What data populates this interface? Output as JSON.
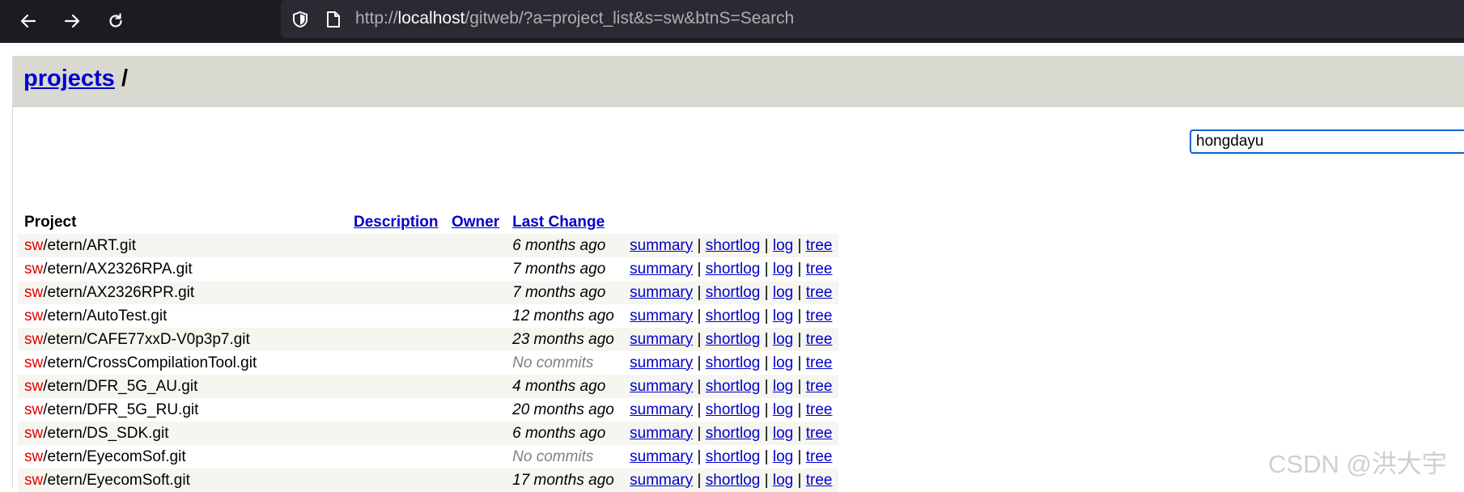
{
  "browser": {
    "url_scheme": "http://",
    "url_host": "localhost",
    "url_path": "/gitweb/?a=project_list&s=sw&btnS=Search"
  },
  "header": {
    "projects_link": "projects",
    "separator": "/"
  },
  "search": {
    "value": "hongdayu"
  },
  "table": {
    "columns": {
      "project": "Project",
      "description": "Description",
      "owner": "Owner",
      "last_change": "Last Change"
    },
    "links": {
      "summary": "summary",
      "shortlog": "shortlog",
      "log": "log",
      "tree": "tree",
      "divider": "|"
    },
    "rows": [
      {
        "prefix": "sw",
        "path": "/etern/ART.git",
        "age": "6 months ago"
      },
      {
        "prefix": "sw",
        "path": "/etern/AX2326RPA.git",
        "age": "7 months ago"
      },
      {
        "prefix": "sw",
        "path": "/etern/AX2326RPR.git",
        "age": "7 months ago"
      },
      {
        "prefix": "sw",
        "path": "/etern/AutoTest.git",
        "age": "12 months ago"
      },
      {
        "prefix": "sw",
        "path": "/etern/CAFE77xxD-V0p3p7.git",
        "age": "23 months ago"
      },
      {
        "prefix": "sw",
        "path": "/etern/CrossCompilationTool.git",
        "age": "No commits"
      },
      {
        "prefix": "sw",
        "path": "/etern/DFR_5G_AU.git",
        "age": "4 months ago"
      },
      {
        "prefix": "sw",
        "path": "/etern/DFR_5G_RU.git",
        "age": "20 months ago"
      },
      {
        "prefix": "sw",
        "path": "/etern/DS_SDK.git",
        "age": "6 months ago"
      },
      {
        "prefix": "sw",
        "path": "/etern/EyecomSof.git",
        "age": "No commits"
      },
      {
        "prefix": "sw",
        "path": "/etern/EyecomSoft.git",
        "age": "17 months ago"
      }
    ]
  },
  "watermark": "CSDN @洪大宇",
  "colors": {
    "link": "#0000cc",
    "match_highlight": "#e00000",
    "header_bg": "#d9d8d1",
    "row_alt_bg": "#f6f6f0",
    "focus_ring": "#0a64d8"
  },
  "icons": [
    "back-arrow-icon",
    "forward-arrow-icon",
    "reload-icon",
    "shield-icon",
    "page-icon"
  ]
}
